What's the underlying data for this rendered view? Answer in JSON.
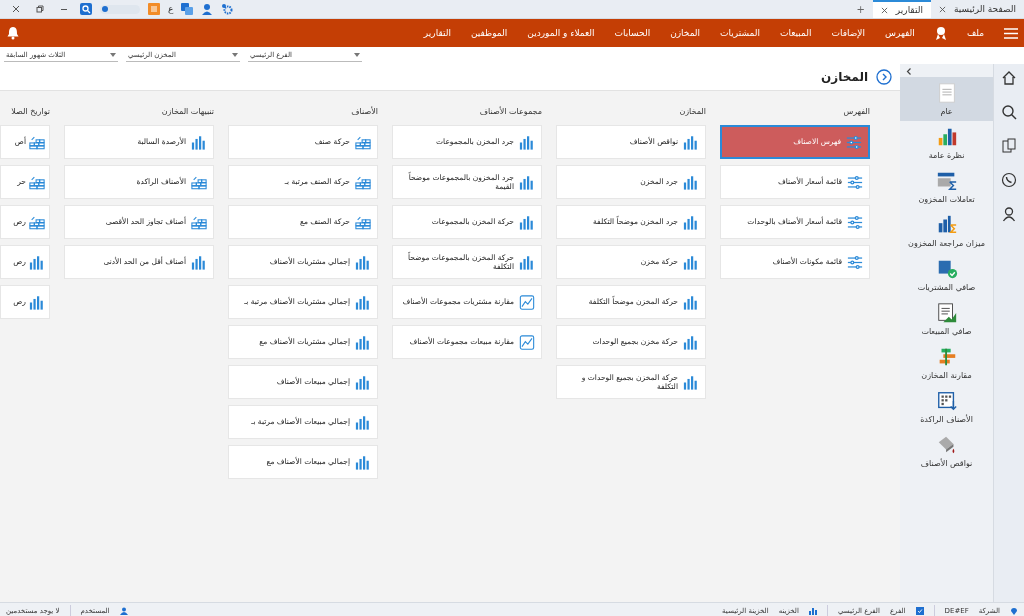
{
  "tabs": [
    {
      "label": "الصفحة الرئيسية",
      "selected": false
    },
    {
      "label": "التقارير",
      "selected": true
    }
  ],
  "new_tab": "+",
  "toolbar": {
    "language": "ع",
    "toggle_on": false
  },
  "menu": {
    "file": "ملف",
    "items": [
      "الفهرس",
      "الإضافات",
      "المبيعات",
      "المشتريات",
      "المخازن",
      "الحسابات",
      "العملاء و الموردين",
      "الموظفين",
      "التقارير"
    ]
  },
  "filters": [
    {
      "value": "الفرع الرئيسي"
    },
    {
      "value": "المخزن الرئيسي"
    },
    {
      "value": "الثلاث شهور السابقة"
    }
  ],
  "page_title": "المخازن",
  "sidebar": {
    "items": [
      {
        "label": "عام",
        "selected": true
      },
      {
        "label": "نظرة عامة",
        "selected": false
      },
      {
        "label": "تعاملات المخزون",
        "selected": false
      },
      {
        "label": "ميزان مراجعة المخزون",
        "selected": false
      },
      {
        "label": "صافي المشتريات",
        "selected": false
      },
      {
        "label": "صافي المبيعات",
        "selected": false
      },
      {
        "label": "مقارنة المخازن",
        "selected": false
      },
      {
        "label": "الأصناف الراكدة",
        "selected": false
      },
      {
        "label": "نواقص الأصناف",
        "selected": false
      }
    ]
  },
  "columns": [
    {
      "title": "الفهرس",
      "items": [
        {
          "label": "فهرس الاصناف",
          "kind": "sliders",
          "selected": true
        },
        {
          "label": "قائمة أسعار الأصناف",
          "kind": "sliders",
          "selected": false
        },
        {
          "label": "قائمة أسعار الأصناف بالوحدات",
          "kind": "sliders",
          "selected": false
        },
        {
          "label": "قائمة مكونات الأصناف",
          "kind": "sliders",
          "selected": false
        }
      ]
    },
    {
      "title": "المخازن",
      "items": [
        {
          "label": "نواقص الأصناف",
          "kind": "bars",
          "selected": false
        },
        {
          "label": "جرد المخزن",
          "kind": "bars",
          "selected": false
        },
        {
          "label": "جرد المخزن موضحاً التكلفة",
          "kind": "bars",
          "selected": false
        },
        {
          "label": "حركة مخزن",
          "kind": "bars",
          "selected": false
        },
        {
          "label": "حركة المخزن موضحاً التكلفة",
          "kind": "bars",
          "selected": false
        },
        {
          "label": "حركة مخزن بجميع الوحدات",
          "kind": "bars",
          "selected": false
        },
        {
          "label": "حركة المخزن بجميع الوحدات و التكلفة",
          "kind": "bars",
          "selected": false
        }
      ]
    },
    {
      "title": "مجموعات الأصناف",
      "items": [
        {
          "label": "جرد المخزن بالمجموعات",
          "kind": "bars",
          "selected": false
        },
        {
          "label": "جرد المخزون بالمجموعات موضحاً القيمة",
          "kind": "bars",
          "selected": false
        },
        {
          "label": "حركة المخزن بالمجموعات",
          "kind": "bars",
          "selected": false
        },
        {
          "label": "حركة المخزن بالمجموعات موضحاً التكلفة",
          "kind": "bars",
          "selected": false
        },
        {
          "label": "مقارنة مشتريات مجموعات الأصناف",
          "kind": "trend",
          "selected": false
        },
        {
          "label": "مقارنة مبيعات مجموعات الأصناف",
          "kind": "trend",
          "selected": false
        }
      ]
    },
    {
      "title": "الأصناف",
      "items": [
        {
          "label": "حركة صنف",
          "kind": "bricks",
          "selected": false
        },
        {
          "label": "حركة الصنف مرتبة بـ",
          "kind": "bricks",
          "selected": false
        },
        {
          "label": "حركة الصنف مع",
          "kind": "bricks",
          "selected": false
        },
        {
          "label": "إجمالي مشتريات الأصناف",
          "kind": "bars",
          "selected": false
        },
        {
          "label": "إجمالي مشتريات الأصناف مرتبة بـ",
          "kind": "bars",
          "selected": false
        },
        {
          "label": "إجمالي مشتريات الأصناف مع",
          "kind": "bars",
          "selected": false
        },
        {
          "label": "إجمالي مبيعات الأصناف",
          "kind": "bars",
          "selected": false
        },
        {
          "label": "إجمالي مبيعات الأصناف مرتبة بـ",
          "kind": "bars",
          "selected": false
        },
        {
          "label": "إجمالي مبيعات الأصناف مع",
          "kind": "bars",
          "selected": false
        }
      ]
    },
    {
      "title": "تنبيهات المخازن",
      "items": [
        {
          "label": "الأرصدة السالبة",
          "kind": "bars",
          "selected": false
        },
        {
          "label": "الأصناف الراكدة",
          "kind": "bricks",
          "selected": false
        },
        {
          "label": "أصناف تجاوز الحد الأقصى",
          "kind": "bricks",
          "selected": false
        },
        {
          "label": "أصناف أقل من الحد الأدنى",
          "kind": "bars",
          "selected": false
        }
      ]
    },
    {
      "title": "تواريخ الصلا",
      "items": [
        {
          "label": "أص",
          "kind": "bricks",
          "selected": false
        },
        {
          "label": "حر",
          "kind": "bricks",
          "selected": false
        },
        {
          "label": "رص",
          "kind": "bricks",
          "selected": false
        },
        {
          "label": "رص",
          "kind": "bars",
          "selected": false
        },
        {
          "label": "رص",
          "kind": "bars",
          "selected": false
        }
      ]
    }
  ],
  "status_bar": {
    "company_label": "الشركة",
    "company": "DE#EF",
    "branch_checked": true,
    "branch_label": "الفرع",
    "branch": "الفرع الرئيسي",
    "treasury_label": "الخزينه",
    "treasury": "الخزينة الرئيسية",
    "user_label": "المستخدم",
    "user": "لا يوجد مستخدمين"
  }
}
